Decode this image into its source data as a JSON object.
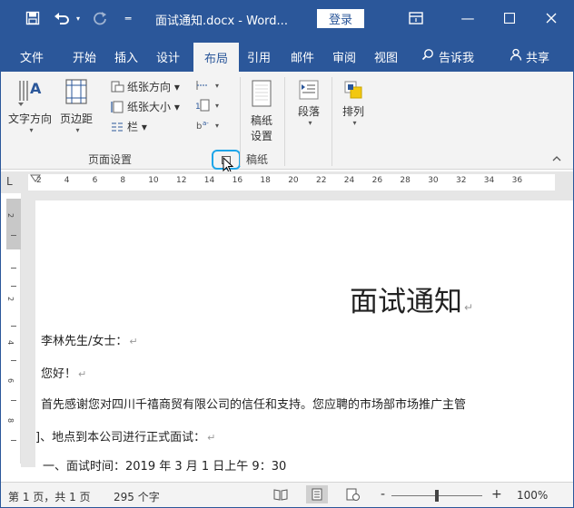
{
  "title_bar": {
    "doc_title": "面试通知.docx - Word...",
    "login_label": "登录",
    "icons": [
      "save-icon",
      "undo-icon",
      "redo-icon",
      "customize-icon",
      "ribbon-display-icon",
      "minimize-icon",
      "maximize-icon",
      "close-icon"
    ],
    "color": "#2b579a"
  },
  "tabs": [
    {
      "label": "文件"
    },
    {
      "label": "开始"
    },
    {
      "label": "插入"
    },
    {
      "label": "设计"
    },
    {
      "label": "布局",
      "active": true
    },
    {
      "label": "引用"
    },
    {
      "label": "邮件"
    },
    {
      "label": "审阅"
    },
    {
      "label": "视图"
    },
    {
      "label": "告诉我"
    },
    {
      "label": "共享"
    }
  ],
  "ribbon": {
    "text_direction": {
      "line1": "文字方向",
      "caret": "▾"
    },
    "margins": {
      "line1": "页边距",
      "caret": "▾"
    },
    "orientation": "纸张方向 ▾",
    "size": "纸张大小 ▾",
    "columns": "栏 ▾",
    "page_setup_label": "页面设置",
    "manuscript": {
      "line1": "稿纸",
      "line2": "设置"
    },
    "manuscript_label": "稿纸",
    "paragraph": {
      "line1": "段落",
      "caret": "▾"
    },
    "arrange": {
      "line1": "排列",
      "caret": "▾"
    },
    "collapse_icon": "chevron-up-icon",
    "highlight_color": "#1ea5e8"
  },
  "ruler": {
    "corner": "L",
    "numbers": [
      "2",
      "4",
      "6",
      "8",
      "10",
      "12",
      "14",
      "16",
      "18",
      "20",
      "22",
      "24",
      "26",
      "28",
      "30",
      "32",
      "34",
      "36"
    ]
  },
  "document": {
    "heading": "面试通知",
    "paragraphs": [
      "李林先生/女士：",
      "您好！",
      "首先感谢您对四川千禧商贸有限公司的信任和支持。您应聘的市场部市场推广主管",
      "]、地点到本公司进行正式面试：",
      "一、面试时间：2019 年 3 月 1 日上午 9：30"
    ],
    "para_mark": "↵"
  },
  "status_bar": {
    "page_info": "第 1 页，共 1 页",
    "word_count": "295 个字",
    "zoom_minus": "-",
    "zoom_plus": "+",
    "zoom_level": "100%",
    "zoom_fraction": 0.5
  }
}
